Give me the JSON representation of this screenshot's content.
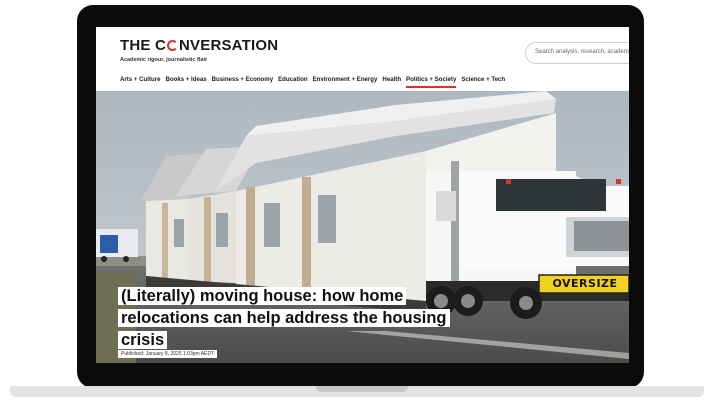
{
  "site": {
    "logo_part1": "THE C",
    "logo_part2": "NVERSATION",
    "tagline": "Academic rigour, journalistic flair",
    "search_placeholder": "Search analysis, research, academic"
  },
  "nav": {
    "items": [
      "Arts + Culture",
      "Books + Ideas",
      "Business + Economy",
      "Education",
      "Environment + Energy",
      "Health",
      "Politics + Society",
      "Science + Tech"
    ],
    "active": "Politics + Society"
  },
  "article": {
    "title": "(Literally) moving house: how home relocations can help address the housing crisis",
    "published": "Published: January 8, 2025 1.03pm AEDT",
    "truck_sign": "OVERSIZE"
  },
  "colors": {
    "accent": "#d8352a",
    "sign_yellow": "#f3d21f"
  }
}
